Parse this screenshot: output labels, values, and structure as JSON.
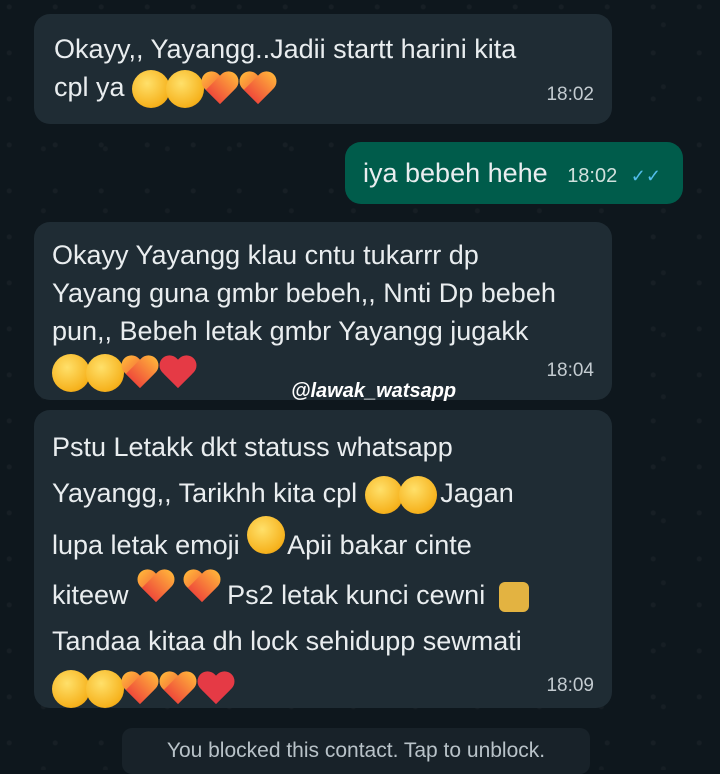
{
  "messages": [
    {
      "id": "m1",
      "direction": "incoming",
      "text_lines": [
        "Okayy,, Yayangg..Jadii startt harini kita",
        "cpl ya"
      ],
      "time": "18:02"
    },
    {
      "id": "m2",
      "direction": "outgoing",
      "text": "iya bebeh hehe",
      "time": "18:02",
      "ticks": "✓✓"
    },
    {
      "id": "m3",
      "direction": "incoming",
      "text_lines": [
        "Okayy Yayangg klau cntu tukarrr dp",
        "Yayang guna gmbr bebeh,, Nnti Dp bebeh",
        "pun,, Bebeh letak gmbr Yayangg jugakk"
      ],
      "time": "18:04"
    },
    {
      "id": "m4",
      "direction": "incoming",
      "text_lines": [
        "Pstu Letakk dkt statuss whatsapp",
        "Yayangg,, Tarikhh kita cpl",
        "Jagan",
        "lupa letak emoji",
        "Apii bakar cinte",
        "kiteew",
        "Ps2 letak kunci cewni",
        "Tandaa kitaa dh lock sehidupp sewmati"
      ],
      "time": "18:09"
    }
  ],
  "watermark": "@lawak_watsapp",
  "blocked_banner": "You blocked this contact. Tap to unblock.",
  "colors": {
    "background": "#0b141a",
    "incoming_bubble": "#1f2c34",
    "outgoing_bubble": "#005c4b",
    "read_ticks": "#53bdeb"
  }
}
